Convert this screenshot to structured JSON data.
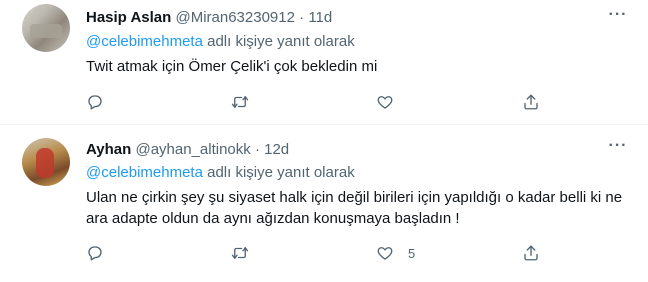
{
  "tweets": [
    {
      "name": "Hasip Aslan",
      "handle": "@Miran63230912",
      "separator": "·",
      "time": "11d",
      "reply_prefix": "@celebimehmeta",
      "reply_suffix": " adlı kişiye yanıt olarak",
      "text": "Twit atmak için Ömer Çelik'i çok bekledin mi",
      "likes": ""
    },
    {
      "name": "Ayhan",
      "handle": "@ayhan_altinokk",
      "separator": "·",
      "time": "12d",
      "reply_prefix": "@celebimehmeta",
      "reply_suffix": " adlı kişiye yanıt olarak",
      "text": "Ulan ne çirkin şey şu siyaset halk için değil birileri için yapıldığı o kadar belli ki ne ara adapte oldun da aynı ağızdan konuşmaya başladın !",
      "likes": "5"
    }
  ],
  "icons": {
    "more": "more-horizontal-icon",
    "reply": "reply-icon",
    "retweet": "retweet-icon",
    "like": "heart-icon",
    "share": "share-icon"
  },
  "colors": {
    "text": "#0f1419",
    "secondary": "#536471",
    "link": "#1d9bf0",
    "divider": "#eff3f4"
  }
}
